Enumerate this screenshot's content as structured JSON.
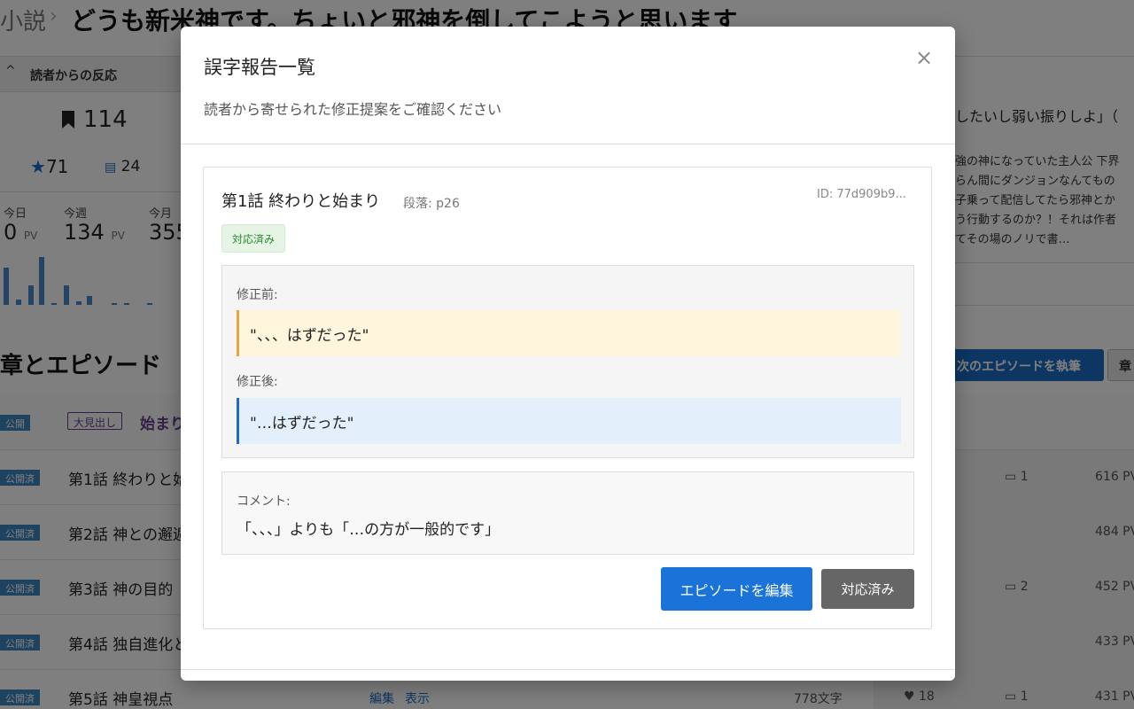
{
  "header": {
    "crumb_parent": "小説",
    "crumb_sep": "›",
    "work_title": "どうも新米神です。ちょいと邪神を倒してこようと思います"
  },
  "reactions": {
    "toggle": "^",
    "label": "読者からの反応",
    "bookmarks": "114",
    "stars": "71",
    "comments": "24",
    "pv": [
      {
        "label": "今日",
        "value": "0",
        "unit": "PV"
      },
      {
        "label": "今週",
        "value": "134",
        "unit": "PV"
      },
      {
        "label": "今月",
        "value": "355",
        "unit": ""
      }
    ]
  },
  "synopsis": {
    "heading": "したいし弱い振りしよ」（",
    "body": "強の神になっていた主人公 下界\nらん間にダンジョンなんてもの\n子乗って配信してたら邪神とか\nう行動するのか？！それは作者\nてその場のノリで書…"
  },
  "episodes_section": {
    "title": "章とエピソード",
    "next_button": "次のエピソードを執筆",
    "chapter_button": "章",
    "chapter_row": {
      "status": "公開",
      "type": "大見出し",
      "title": "始まり"
    },
    "rows": [
      {
        "status": "公開済",
        "title": "第1話 終わりと始",
        "edit": "",
        "view": "",
        "chars": "",
        "likes": "",
        "comments": "1",
        "pv": "616 PV"
      },
      {
        "status": "公開済",
        "title": "第2話 神との邂逅",
        "edit": "",
        "view": "",
        "chars": "",
        "likes": "",
        "comments": "",
        "pv": "484 PV"
      },
      {
        "status": "公開済",
        "title": "第3話 神の目的",
        "edit": "",
        "view": "",
        "chars": "",
        "likes": "",
        "comments": "2",
        "pv": "452 PV"
      },
      {
        "status": "公開済",
        "title": "第4話 独自進化と",
        "edit": "",
        "view": "",
        "chars": "",
        "likes": "",
        "comments": "",
        "pv": "433 PV"
      },
      {
        "status": "公開済",
        "title": "第5話 神皇視点",
        "edit": "編集",
        "view": "表示",
        "chars": "778文字",
        "likes": "18",
        "comments": "1",
        "pv": "431 PV"
      }
    ]
  },
  "modal": {
    "title": "誤字報告一覧",
    "close": "×",
    "subtitle": "読者から寄せられた修正提案をご確認ください",
    "report": {
      "episode_title": "第1話 終わりと始まり",
      "paragraph": "段落: p26",
      "id": "ID: 77d909b9...",
      "status": "対応済み",
      "before_label": "修正前:",
      "before_text": "\"、、、はずだった\"",
      "after_label": "修正後:",
      "after_text": "\"…はずだった\"",
      "comment_label": "コメント:",
      "comment_text": "「、、、」よりも「…の方が一般的です」",
      "edit_button": "エピソードを編集",
      "done_button": "対応済み"
    }
  },
  "colors": {
    "primary": "#1a73d9",
    "status_done": "#2a8a2a",
    "before_accent": "#e5a93a",
    "after_accent": "#1a6cc6",
    "chapter_accent": "#6b3c91"
  }
}
